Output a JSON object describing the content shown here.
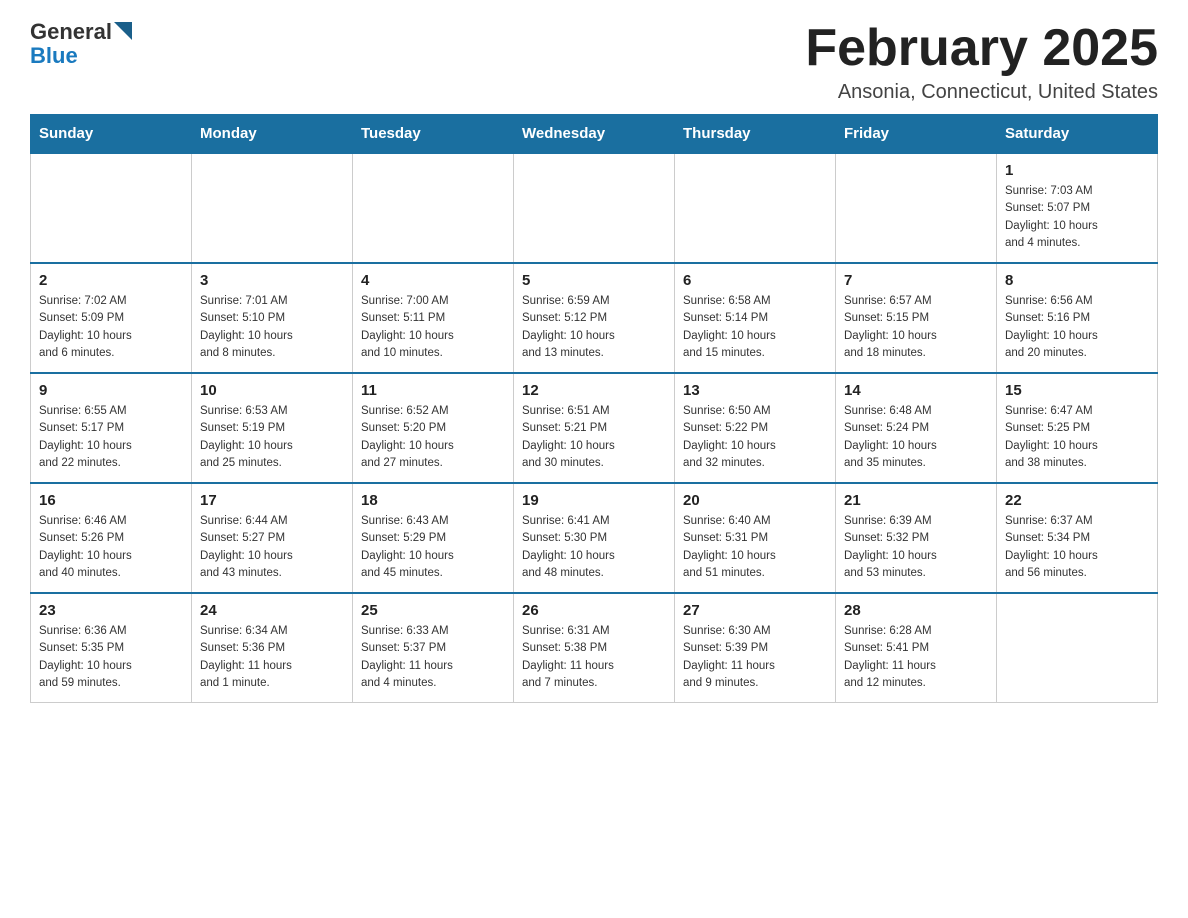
{
  "logo": {
    "general": "General",
    "blue": "Blue"
  },
  "title": "February 2025",
  "location": "Ansonia, Connecticut, United States",
  "weekdays": [
    "Sunday",
    "Monday",
    "Tuesday",
    "Wednesday",
    "Thursday",
    "Friday",
    "Saturday"
  ],
  "weeks": [
    [
      {
        "day": "",
        "info": ""
      },
      {
        "day": "",
        "info": ""
      },
      {
        "day": "",
        "info": ""
      },
      {
        "day": "",
        "info": ""
      },
      {
        "day": "",
        "info": ""
      },
      {
        "day": "",
        "info": ""
      },
      {
        "day": "1",
        "info": "Sunrise: 7:03 AM\nSunset: 5:07 PM\nDaylight: 10 hours\nand 4 minutes."
      }
    ],
    [
      {
        "day": "2",
        "info": "Sunrise: 7:02 AM\nSunset: 5:09 PM\nDaylight: 10 hours\nand 6 minutes."
      },
      {
        "day": "3",
        "info": "Sunrise: 7:01 AM\nSunset: 5:10 PM\nDaylight: 10 hours\nand 8 minutes."
      },
      {
        "day": "4",
        "info": "Sunrise: 7:00 AM\nSunset: 5:11 PM\nDaylight: 10 hours\nand 10 minutes."
      },
      {
        "day": "5",
        "info": "Sunrise: 6:59 AM\nSunset: 5:12 PM\nDaylight: 10 hours\nand 13 minutes."
      },
      {
        "day": "6",
        "info": "Sunrise: 6:58 AM\nSunset: 5:14 PM\nDaylight: 10 hours\nand 15 minutes."
      },
      {
        "day": "7",
        "info": "Sunrise: 6:57 AM\nSunset: 5:15 PM\nDaylight: 10 hours\nand 18 minutes."
      },
      {
        "day": "8",
        "info": "Sunrise: 6:56 AM\nSunset: 5:16 PM\nDaylight: 10 hours\nand 20 minutes."
      }
    ],
    [
      {
        "day": "9",
        "info": "Sunrise: 6:55 AM\nSunset: 5:17 PM\nDaylight: 10 hours\nand 22 minutes."
      },
      {
        "day": "10",
        "info": "Sunrise: 6:53 AM\nSunset: 5:19 PM\nDaylight: 10 hours\nand 25 minutes."
      },
      {
        "day": "11",
        "info": "Sunrise: 6:52 AM\nSunset: 5:20 PM\nDaylight: 10 hours\nand 27 minutes."
      },
      {
        "day": "12",
        "info": "Sunrise: 6:51 AM\nSunset: 5:21 PM\nDaylight: 10 hours\nand 30 minutes."
      },
      {
        "day": "13",
        "info": "Sunrise: 6:50 AM\nSunset: 5:22 PM\nDaylight: 10 hours\nand 32 minutes."
      },
      {
        "day": "14",
        "info": "Sunrise: 6:48 AM\nSunset: 5:24 PM\nDaylight: 10 hours\nand 35 minutes."
      },
      {
        "day": "15",
        "info": "Sunrise: 6:47 AM\nSunset: 5:25 PM\nDaylight: 10 hours\nand 38 minutes."
      }
    ],
    [
      {
        "day": "16",
        "info": "Sunrise: 6:46 AM\nSunset: 5:26 PM\nDaylight: 10 hours\nand 40 minutes."
      },
      {
        "day": "17",
        "info": "Sunrise: 6:44 AM\nSunset: 5:27 PM\nDaylight: 10 hours\nand 43 minutes."
      },
      {
        "day": "18",
        "info": "Sunrise: 6:43 AM\nSunset: 5:29 PM\nDaylight: 10 hours\nand 45 minutes."
      },
      {
        "day": "19",
        "info": "Sunrise: 6:41 AM\nSunset: 5:30 PM\nDaylight: 10 hours\nand 48 minutes."
      },
      {
        "day": "20",
        "info": "Sunrise: 6:40 AM\nSunset: 5:31 PM\nDaylight: 10 hours\nand 51 minutes."
      },
      {
        "day": "21",
        "info": "Sunrise: 6:39 AM\nSunset: 5:32 PM\nDaylight: 10 hours\nand 53 minutes."
      },
      {
        "day": "22",
        "info": "Sunrise: 6:37 AM\nSunset: 5:34 PM\nDaylight: 10 hours\nand 56 minutes."
      }
    ],
    [
      {
        "day": "23",
        "info": "Sunrise: 6:36 AM\nSunset: 5:35 PM\nDaylight: 10 hours\nand 59 minutes."
      },
      {
        "day": "24",
        "info": "Sunrise: 6:34 AM\nSunset: 5:36 PM\nDaylight: 11 hours\nand 1 minute."
      },
      {
        "day": "25",
        "info": "Sunrise: 6:33 AM\nSunset: 5:37 PM\nDaylight: 11 hours\nand 4 minutes."
      },
      {
        "day": "26",
        "info": "Sunrise: 6:31 AM\nSunset: 5:38 PM\nDaylight: 11 hours\nand 7 minutes."
      },
      {
        "day": "27",
        "info": "Sunrise: 6:30 AM\nSunset: 5:39 PM\nDaylight: 11 hours\nand 9 minutes."
      },
      {
        "day": "28",
        "info": "Sunrise: 6:28 AM\nSunset: 5:41 PM\nDaylight: 11 hours\nand 12 minutes."
      },
      {
        "day": "",
        "info": ""
      }
    ]
  ]
}
